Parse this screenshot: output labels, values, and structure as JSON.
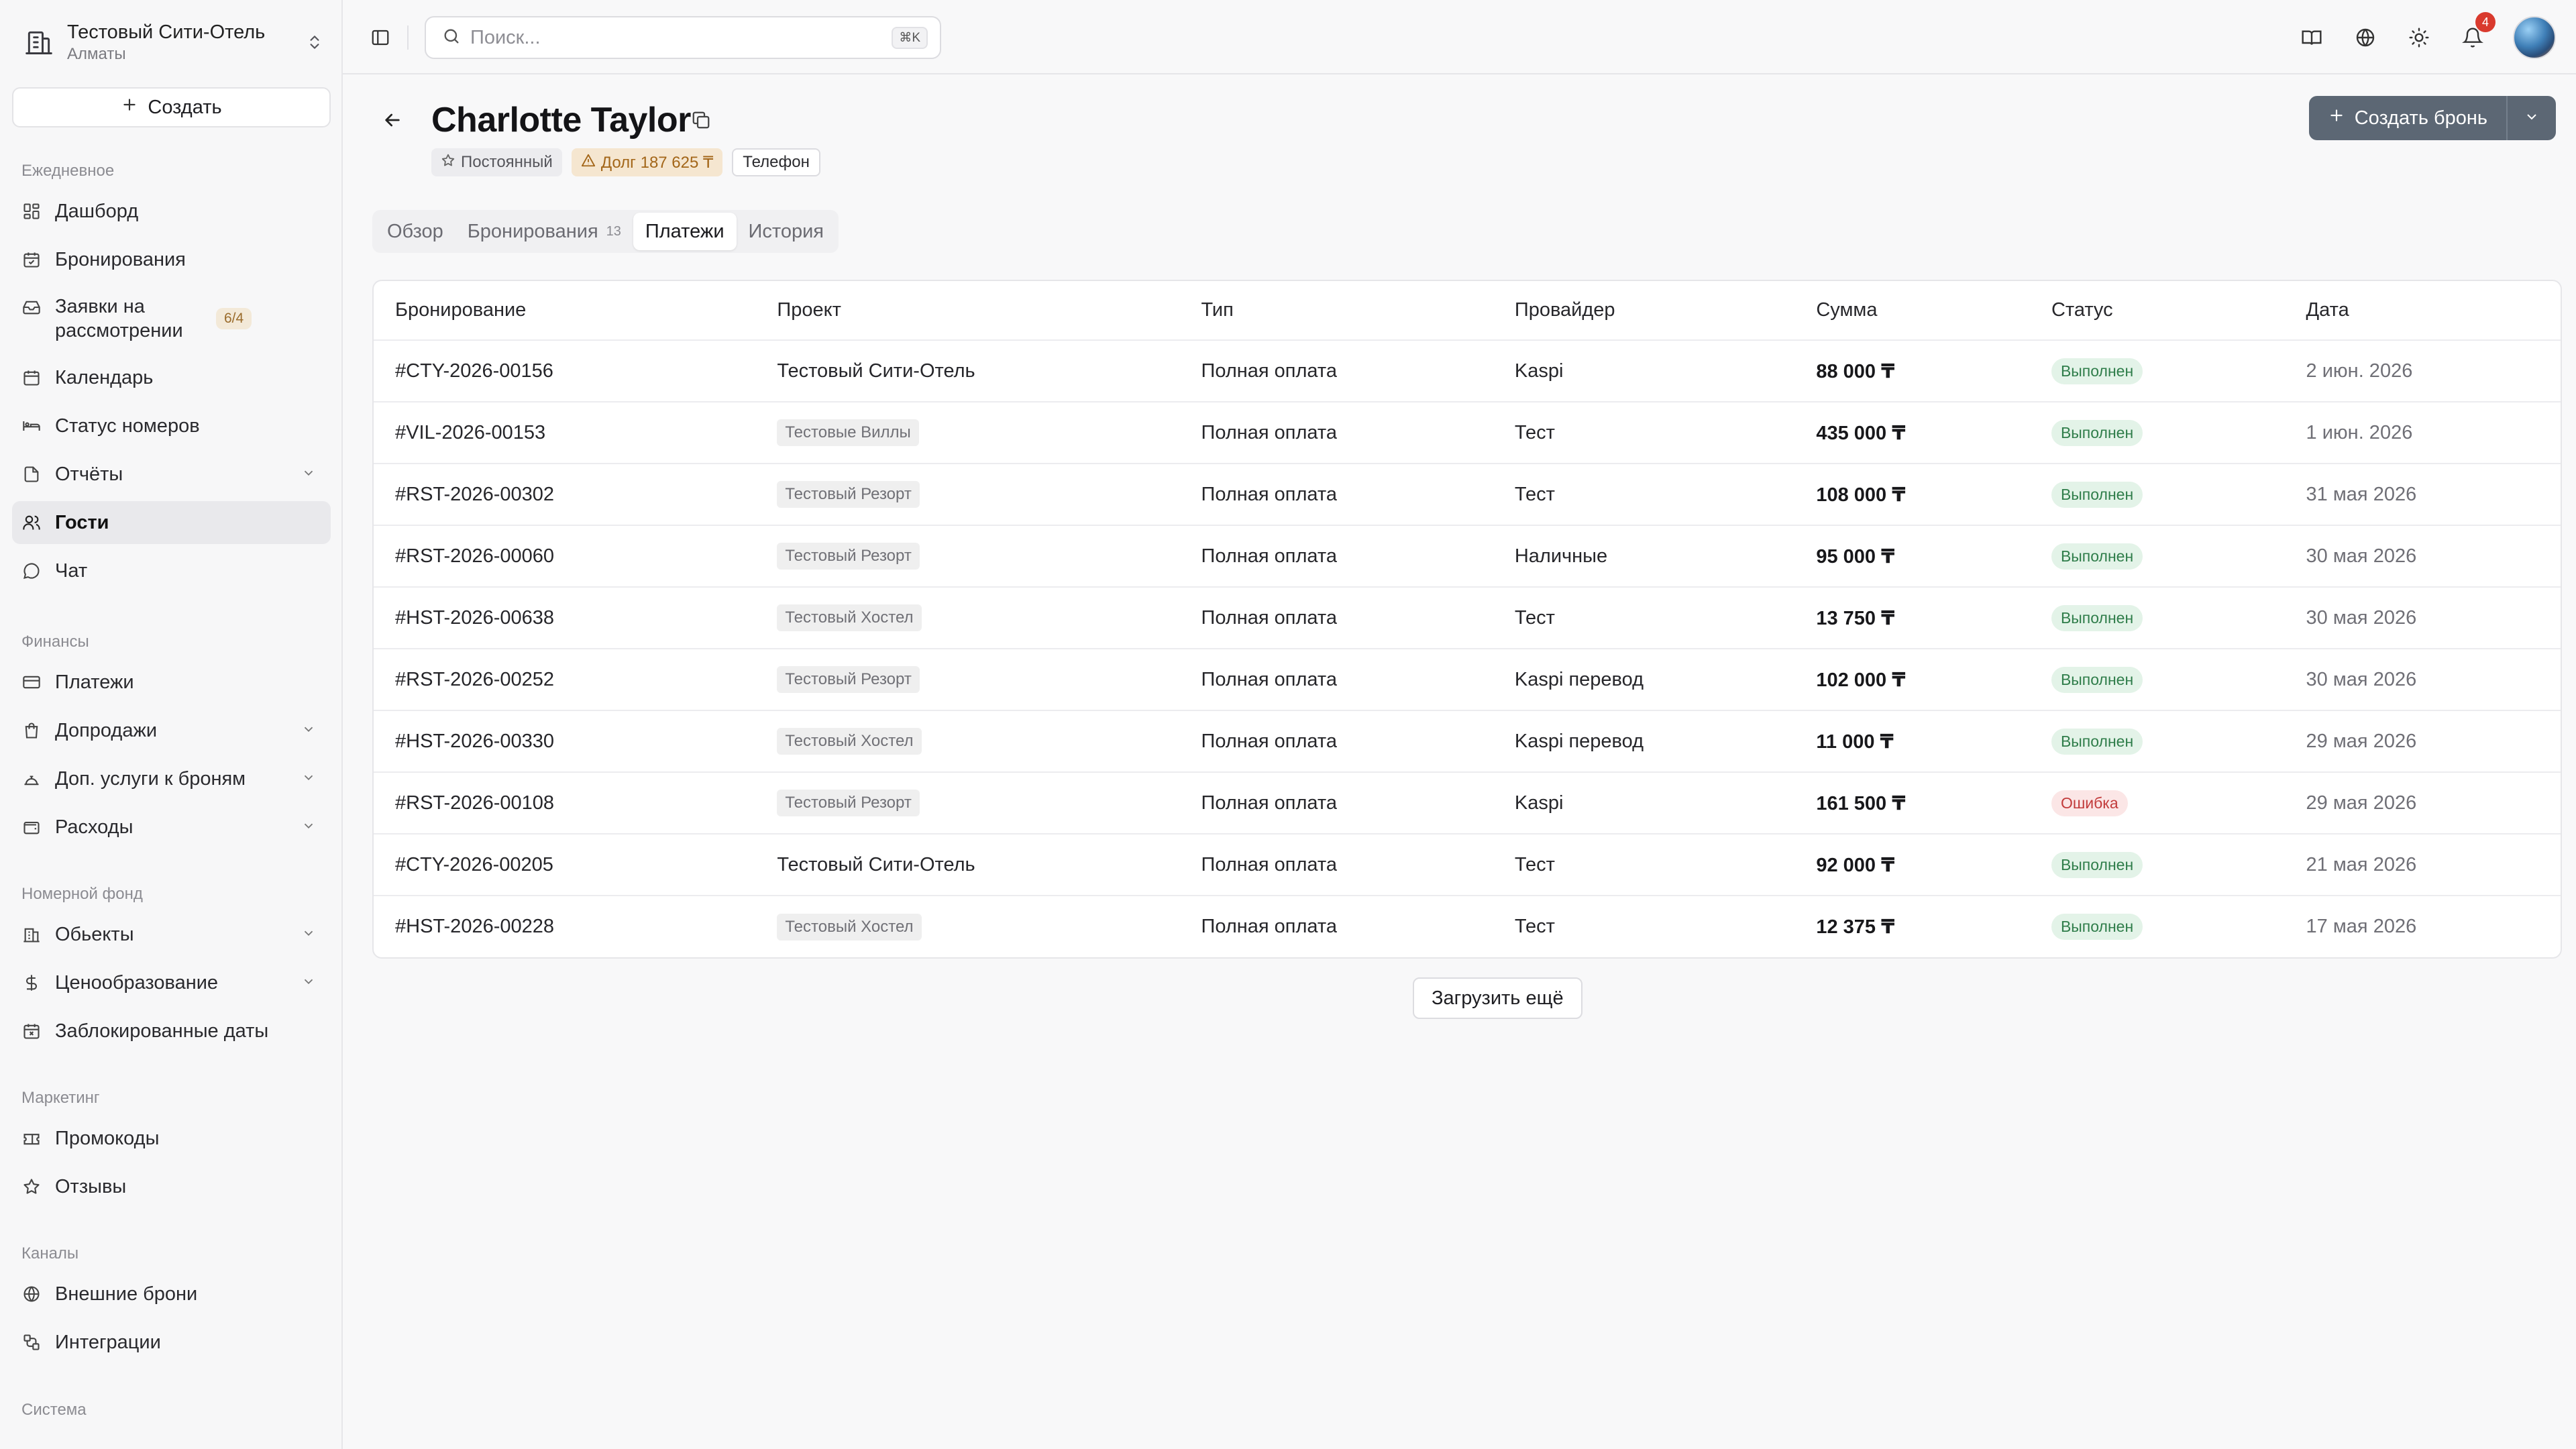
{
  "sidebar": {
    "hotel_name": "Тестовый Сити-Отель",
    "hotel_city": "Алматы",
    "create_label": "Создать",
    "groups": [
      {
        "title": "Ежедневное",
        "items": [
          {
            "label": "Дашборд",
            "icon": "dashboard-icon"
          },
          {
            "label": "Бронирования",
            "icon": "calendar-check-icon"
          },
          {
            "label": "Заявки на рассмотрении",
            "icon": "inbox-icon",
            "badge": "6/4"
          },
          {
            "label": "Календарь",
            "icon": "calendar-icon"
          },
          {
            "label": "Статус номеров",
            "icon": "bed-icon"
          },
          {
            "label": "Отчёты",
            "icon": "file-icon"
          },
          {
            "label": "Гости",
            "icon": "users-icon"
          },
          {
            "label": "Чат",
            "icon": "chat-icon"
          }
        ]
      },
      {
        "title": "Финансы",
        "items": [
          {
            "label": "Платежи",
            "icon": "credit-card-icon"
          },
          {
            "label": "Допродажи",
            "icon": "bag-icon"
          },
          {
            "label": "Доп. услуги к броням",
            "icon": "service-icon"
          },
          {
            "label": "Расходы",
            "icon": "wallet-icon"
          }
        ]
      },
      {
        "title": "Номерной фонд",
        "items": [
          {
            "label": "Обьекты",
            "icon": "building-icon"
          },
          {
            "label": "Ценообразование",
            "icon": "dollar-icon"
          },
          {
            "label": "Заблокированные даты",
            "icon": "calendar-x-icon"
          }
        ]
      },
      {
        "title": "Маркетинг",
        "items": [
          {
            "label": "Промокоды",
            "icon": "ticket-icon"
          },
          {
            "label": "Отзывы",
            "icon": "star-icon"
          }
        ]
      },
      {
        "title": "Каналы",
        "items": [
          {
            "label": "Внешние брони",
            "icon": "globe-icon"
          },
          {
            "label": "Интеграции",
            "icon": "integration-icon"
          }
        ]
      },
      {
        "title": "Система",
        "items": []
      }
    ]
  },
  "topbar": {
    "search_placeholder": "Поиск...",
    "search_shortcut": "⌘K",
    "notification_count": "4"
  },
  "guest": {
    "name": "Charlotte Taylor",
    "badge_regular": "Постоянный",
    "badge_debt": "Долг 187 625 ₸",
    "badge_phone": "Телефон"
  },
  "actions": {
    "create_booking": "Создать бронь",
    "load_more": "Загрузить ещё"
  },
  "tabs": [
    {
      "label": "Обзор",
      "count": ""
    },
    {
      "label": "Бронирования",
      "count": "13"
    },
    {
      "label": "Платежи",
      "count": ""
    },
    {
      "label": "История",
      "count": ""
    }
  ],
  "active_tab": "Платежи",
  "table": {
    "headers": [
      "Бронирование",
      "Проект",
      "Тип",
      "Провайдер",
      "Сумма",
      "Статус",
      "Дата"
    ],
    "rows": [
      {
        "booking": "#CTY-2026-00156",
        "project": "Тестовый Сити-Отель",
        "project_pill": false,
        "type": "Полная оплата",
        "provider": "Kaspi",
        "amount": "88 000 ₸",
        "status": "Выполнен",
        "status_kind": "ok",
        "date": "2 июн. 2026"
      },
      {
        "booking": "#VIL-2026-00153",
        "project": "Тестовые Виллы",
        "project_pill": true,
        "type": "Полная оплата",
        "provider": "Тест",
        "amount": "435 000 ₸",
        "status": "Выполнен",
        "status_kind": "ok",
        "date": "1 июн. 2026"
      },
      {
        "booking": "#RST-2026-00302",
        "project": "Тестовый Резорт",
        "project_pill": true,
        "type": "Полная оплата",
        "provider": "Тест",
        "amount": "108 000 ₸",
        "status": "Выполнен",
        "status_kind": "ok",
        "date": "31 мая 2026"
      },
      {
        "booking": "#RST-2026-00060",
        "project": "Тестовый Резорт",
        "project_pill": true,
        "type": "Полная оплата",
        "provider": "Наличные",
        "amount": "95 000 ₸",
        "status": "Выполнен",
        "status_kind": "ok",
        "date": "30 мая 2026"
      },
      {
        "booking": "#HST-2026-00638",
        "project": "Тестовый Хостел",
        "project_pill": true,
        "type": "Полная оплата",
        "provider": "Тест",
        "amount": "13 750 ₸",
        "status": "Выполнен",
        "status_kind": "ok",
        "date": "30 мая 2026"
      },
      {
        "booking": "#RST-2026-00252",
        "project": "Тестовый Резорт",
        "project_pill": true,
        "type": "Полная оплата",
        "provider": "Kaspi перевод",
        "amount": "102 000 ₸",
        "status": "Выполнен",
        "status_kind": "ok",
        "date": "30 мая 2026"
      },
      {
        "booking": "#HST-2026-00330",
        "project": "Тестовый Хостел",
        "project_pill": true,
        "type": "Полная оплата",
        "provider": "Kaspi перевод",
        "amount": "11 000 ₸",
        "status": "Выполнен",
        "status_kind": "ok",
        "date": "29 мая 2026"
      },
      {
        "booking": "#RST-2026-00108",
        "project": "Тестовый Резорт",
        "project_pill": true,
        "type": "Полная оплата",
        "provider": "Kaspi",
        "amount": "161 500 ₸",
        "status": "Ошибка",
        "status_kind": "err",
        "date": "29 мая 2026"
      },
      {
        "booking": "#CTY-2026-00205",
        "project": "Тестовый Сити-Отель",
        "project_pill": false,
        "type": "Полная оплата",
        "provider": "Тест",
        "amount": "92 000 ₸",
        "status": "Выполнен",
        "status_kind": "ok",
        "date": "21 мая 2026"
      },
      {
        "booking": "#HST-2026-00228",
        "project": "Тестовый Хостел",
        "project_pill": true,
        "type": "Полная оплата",
        "provider": "Тест",
        "amount": "12 375 ₸",
        "status": "Выполнен",
        "status_kind": "ok",
        "date": "17 мая 2026"
      }
    ]
  },
  "colors": {
    "accent_button": "#5c6774",
    "status_ok": "#2f7d4a",
    "status_error": "#c23b3b",
    "debt": "#a36619",
    "notification": "#d93a2e"
  }
}
